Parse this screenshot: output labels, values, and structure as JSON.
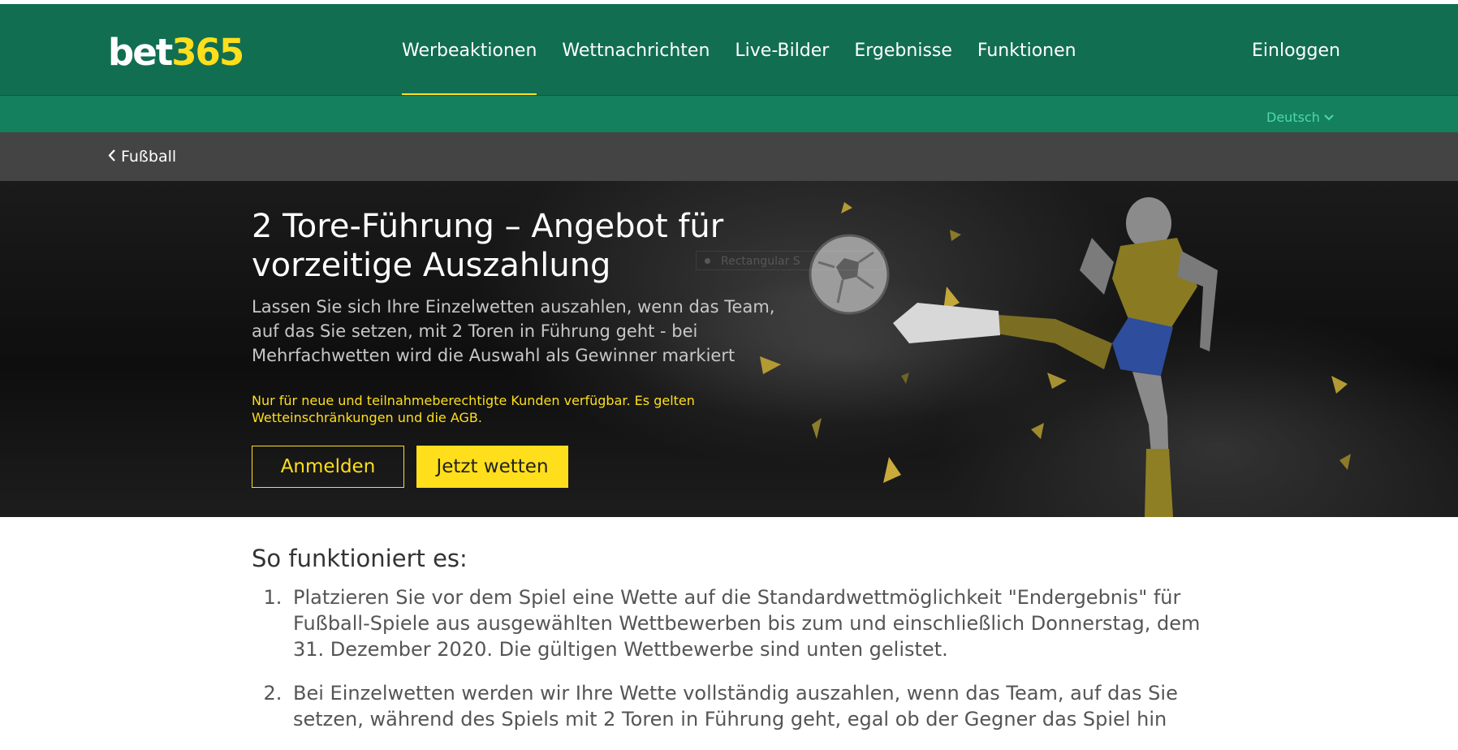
{
  "header": {
    "logo_white": "bet",
    "logo_yellow": "365",
    "nav": [
      "Werbeaktionen",
      "Wettnachrichten",
      "Live-Bilder",
      "Ergebnisse",
      "Funktionen"
    ],
    "login": "Einloggen",
    "language": "Deutsch"
  },
  "breadcrumb": {
    "label": "Fußball"
  },
  "hero": {
    "title": "2 Tore-Führung – Angebot für vorzeitige Auszahlung",
    "subtitle": "Lassen Sie sich Ihre Einzelwetten auszahlen, wenn das Team, auf das Sie setzen, mit 2 Toren in Führung geht - bei Mehrfachwetten wird die Auswahl als Gewinner markiert",
    "note": "Nur für neue und teilnahmeberechtigte Kunden verfügbar. Es gelten Wetteinschränkungen und die AGB.",
    "register_label": "Anmelden",
    "bet_now_label": "Jetzt wetten",
    "ghost_label": "Rectangular S"
  },
  "content": {
    "heading": "So funktioniert es:",
    "steps": [
      "Platzieren Sie vor dem Spiel eine Wette auf die Standardwettmöglichkeit \"Endergebnis\" für Fußball-Spiele aus ausgewählten Wettbewerben bis zum und einschließlich Donnerstag, dem 31. Dezember 2020. Die gültigen Wettbewerbe sind unten gelistet.",
      "Bei Einzelwetten werden wir Ihre Wette vollständig auszahlen, wenn das Team, auf das Sie setzen, während des Spiels mit 2 Toren in Führung geht, egal ob der Gegner das Spiel hin"
    ]
  },
  "colors": {
    "brand_green": "#126e51",
    "brand_yellow": "#ffdf1b",
    "breadcrumb_bg": "#444444"
  }
}
